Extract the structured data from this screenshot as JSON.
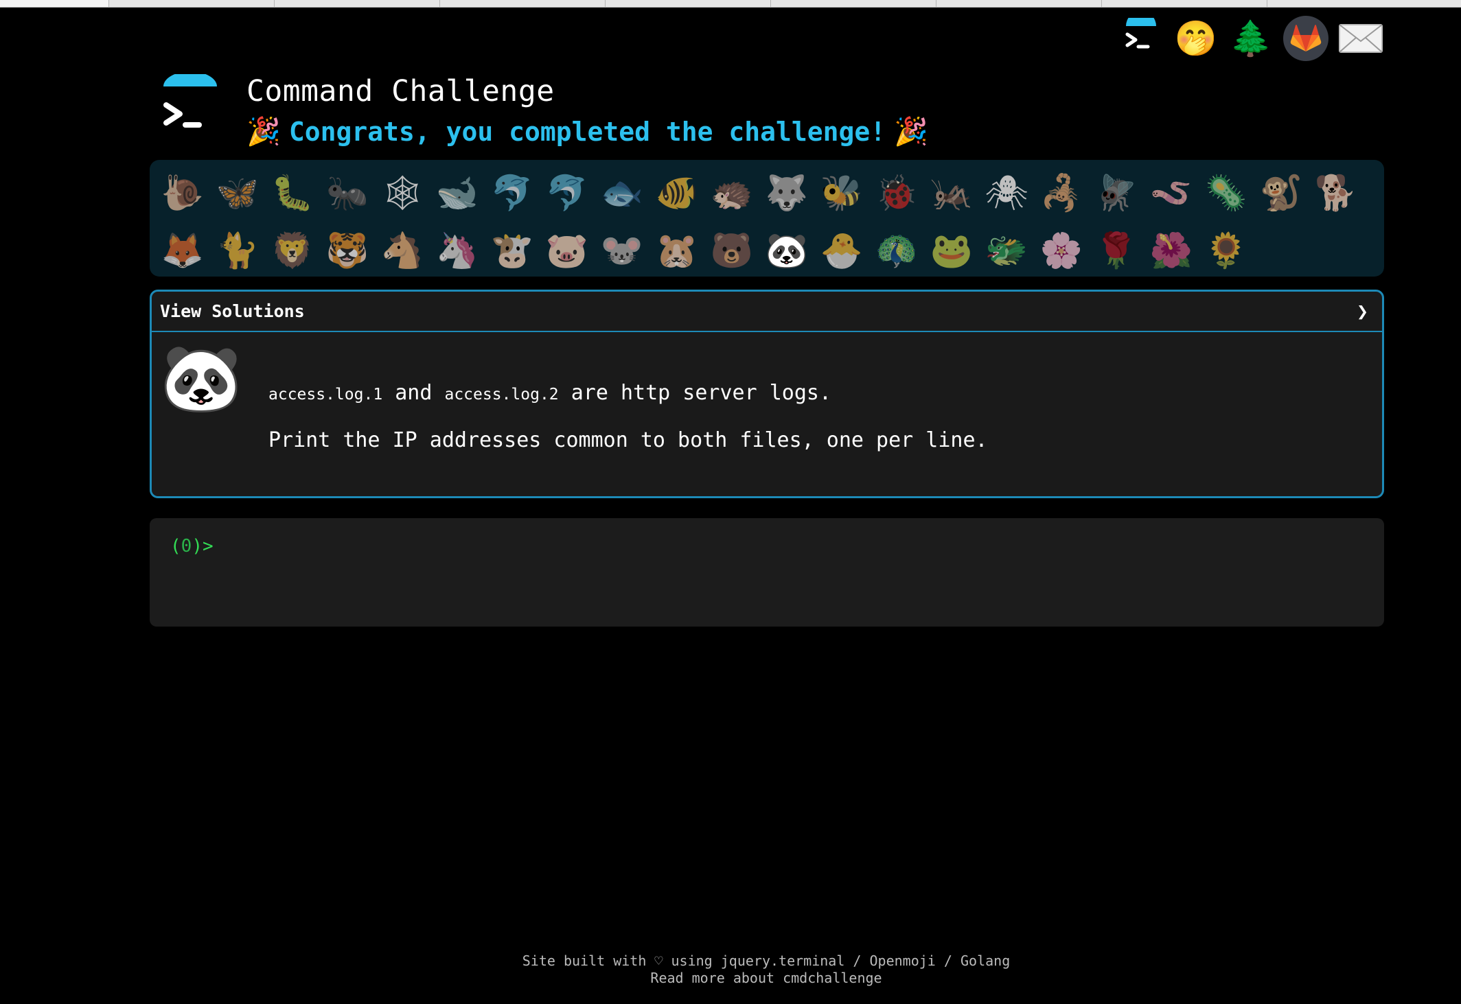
{
  "header": {
    "title": "Command Challenge",
    "subtitle": "Congrats, you completed the challenge!",
    "party_emoji": "🎉"
  },
  "top_icons": [
    {
      "name": "terminal-icon"
    },
    {
      "name": "secret-icon",
      "emoji": "🤭"
    },
    {
      "name": "tree-icon",
      "emoji": "🌲"
    },
    {
      "name": "gitlab-icon"
    },
    {
      "name": "mail-icon",
      "emoji": "✉"
    }
  ],
  "challenges": {
    "row1": [
      "🐌",
      "🦋",
      "🐛",
      "🐜",
      "🕸",
      "🐋",
      "🐬",
      "🐬",
      "🐟",
      "🐠",
      "🦔",
      "🐺",
      "🐝",
      "🐞",
      "🦗",
      "🕷",
      "🦂",
      "🪰",
      "🪱",
      "🦠",
      "🐒",
      "🐕"
    ],
    "row2": [
      "🦊",
      "🐈",
      "🦁",
      "🐯",
      "🐴",
      "🦄",
      "🐮",
      "🐷",
      "🐭",
      "🐹",
      "🐻",
      "🐼",
      "🐣",
      "🦚",
      "🐸",
      "🐲",
      "🌸",
      "🌹",
      "🌺",
      "🌻"
    ],
    "current_index_row2": 11
  },
  "solution_panel": {
    "header_label": "View Solutions",
    "chevron": "❯",
    "avatar_emoji": "🐼",
    "file1": "access.log.1",
    "and_text": "and",
    "file2": "access.log.2",
    "line1_rest": "are http server logs.",
    "line2": "Print the IP addresses common to both files, one per line."
  },
  "terminal": {
    "prompt_open": "(",
    "prompt_num": "0",
    "prompt_close": ")>"
  },
  "footer": {
    "line1_prefix": "Site built with ♡ using",
    "jquery": "jquery.terminal",
    "sep1": "/",
    "openmoji": "Openmoji",
    "sep2": "/",
    "golang": "Golang",
    "line2": "Read more about cmdchallenge"
  },
  "colors": {
    "accent": "#2cc0ee",
    "panel_border": "#1d8ab7",
    "prompt_green": "#33dd55"
  }
}
